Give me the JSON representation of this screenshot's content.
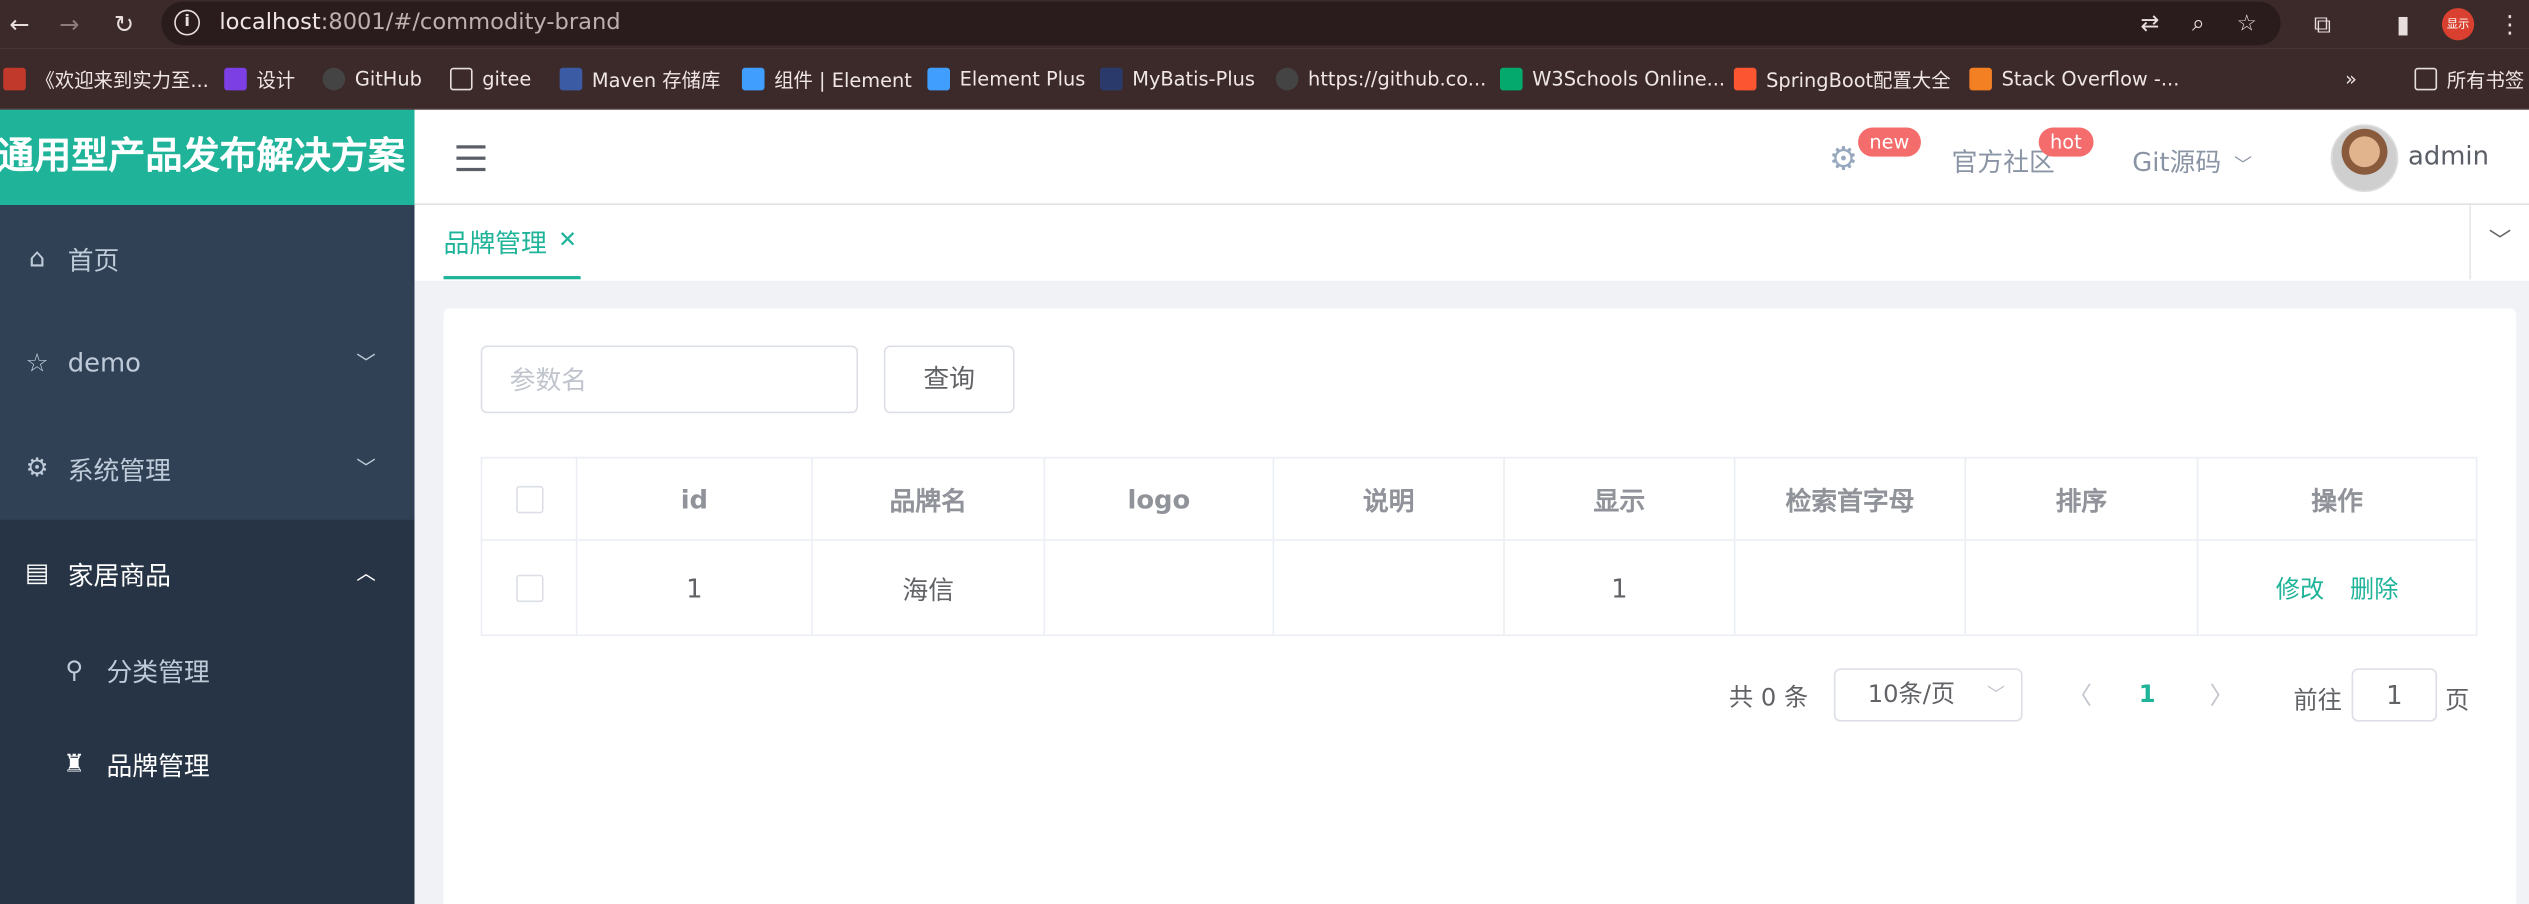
{
  "browser": {
    "url_host": "localhost",
    "url_rest": ":8001/#/commodity-brand",
    "profile_badge": "显示",
    "bookmarks": [
      {
        "label": "《欢迎来到实力至...",
        "icon": "bookmark-favicon-icon",
        "color": "#c0392b"
      },
      {
        "label": "设计",
        "icon": "design-favicon-icon",
        "color": "#7b3fe4"
      },
      {
        "label": "GitHub",
        "icon": "github-icon",
        "color": "#444444"
      },
      {
        "label": "gitee",
        "icon": "folder-icon",
        "color": "#3c2a2a"
      },
      {
        "label": "Maven 存储库",
        "icon": "maven-favicon-icon",
        "color": "#3b5ba5"
      },
      {
        "label": "组件 | Element",
        "icon": "element-favicon-icon",
        "color": "#409eff"
      },
      {
        "label": "Element Plus",
        "icon": "element-plus-favicon-icon",
        "color": "#409eff"
      },
      {
        "label": "MyBatis-Plus",
        "icon": "mybatis-favicon-icon",
        "color": "#2a3a6a"
      },
      {
        "label": "https://github.co...",
        "icon": "github-icon",
        "color": "#444444"
      },
      {
        "label": "W3Schools Online...",
        "icon": "w3schools-favicon-icon",
        "color": "#04aa6d"
      },
      {
        "label": "SpringBoot配置大全",
        "icon": "csdn-favicon-icon",
        "color": "#fc5531"
      },
      {
        "label": "Stack Overflow -...",
        "icon": "stackoverflow-favicon-icon",
        "color": "#f48024"
      }
    ],
    "more_label": "»",
    "all_bookmarks": "所有书签"
  },
  "app": {
    "logo_text": "通用型产品发布解决方案",
    "accent": "#1fb39a",
    "sidebar_bg": "#304156"
  },
  "sidebar": {
    "items": [
      {
        "label": "首页",
        "icon": "home-icon"
      },
      {
        "label": "demo",
        "icon": "star-icon"
      },
      {
        "label": "系统管理",
        "icon": "gear-icon"
      },
      {
        "label": "家居商品",
        "icon": "document-icon"
      }
    ],
    "sub_items": [
      {
        "label": "分类管理",
        "icon": "category-icon"
      },
      {
        "label": "品牌管理",
        "icon": "brand-icon"
      }
    ]
  },
  "navbar": {
    "badge_new": "new",
    "community": "官方社区",
    "badge_hot": "hot",
    "git": "Git源码",
    "user": "admin"
  },
  "tags": {
    "active": "品牌管理"
  },
  "search": {
    "placeholder": "参数名",
    "button": "查询"
  },
  "table": {
    "headers": [
      "id",
      "品牌名",
      "logo",
      "说明",
      "显示",
      "检索首字母",
      "排序",
      "操作"
    ],
    "rows": [
      {
        "id": "1",
        "name": "海信",
        "logo": "",
        "desc": "",
        "show": "1",
        "first_letter": "",
        "sort": "",
        "edit": "修改",
        "delete": "删除"
      }
    ]
  },
  "pagination": {
    "total": "共 0 条",
    "page_size": "10条/页",
    "current": "1",
    "goto_label": "前往",
    "goto_value": "1",
    "goto_suffix": "页"
  }
}
